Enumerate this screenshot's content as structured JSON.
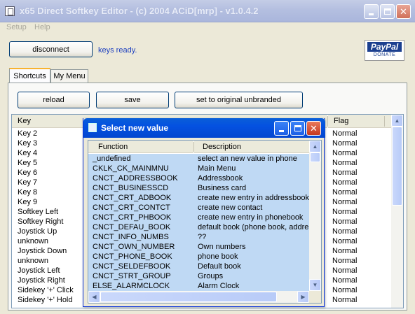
{
  "window": {
    "title": "x65 Direct Softkey Editor - (c) 2004 ACiD[mrp] - v1.0.4.2"
  },
  "menu": {
    "items": [
      "Setup",
      "Help"
    ]
  },
  "toolbar": {
    "disconnect_label": "disconnect",
    "status_text": "keys ready."
  },
  "donate": {
    "brand": "PayPal",
    "label": "DONATE"
  },
  "tabs": [
    {
      "label": "Shortcuts",
      "active": true
    },
    {
      "label": "My Menu",
      "active": false
    }
  ],
  "actions": {
    "reload_label": "reload",
    "save_label": "save",
    "reset_label": "set to original unbranded"
  },
  "key_list": {
    "columns": {
      "key": "Key",
      "flag": "Flag"
    },
    "rows": [
      {
        "key": "Key 2",
        "flag": "Normal"
      },
      {
        "key": "Key 3",
        "flag": "Normal"
      },
      {
        "key": "Key 4",
        "flag": "Normal"
      },
      {
        "key": "Key 5",
        "flag": "Normal"
      },
      {
        "key": "Key 6",
        "flag": "Normal"
      },
      {
        "key": "Key 7",
        "flag": "Normal"
      },
      {
        "key": "Key 8",
        "flag": "Normal"
      },
      {
        "key": "Key 9",
        "flag": "Normal"
      },
      {
        "key": "Softkey Left",
        "flag": "Normal"
      },
      {
        "key": "Softkey Right",
        "flag": "Normal"
      },
      {
        "key": "Joystick Up",
        "flag": "Normal"
      },
      {
        "key": "unknown",
        "flag": "Normal"
      },
      {
        "key": "Joystick Down",
        "flag": "Normal"
      },
      {
        "key": "unknown",
        "flag": "Normal"
      },
      {
        "key": "Joystick Left",
        "flag": "Normal"
      },
      {
        "key": "Joystick Right",
        "flag": "Normal"
      },
      {
        "key": "Sidekey '+' Click",
        "flag": "Normal"
      },
      {
        "key": "Sidekey '+' Hold",
        "flag": "Normal"
      }
    ]
  },
  "dialog": {
    "title": "Select new value",
    "columns": {
      "function": "Function",
      "description": "Description"
    },
    "rows": [
      {
        "function": "_undefined",
        "description": "select an new value in phone"
      },
      {
        "function": "CKLK_CK_MAINMNU",
        "description": "Main Menu"
      },
      {
        "function": "CNCT_ADDRESSBOOK",
        "description": "Addressbook"
      },
      {
        "function": "CNCT_BUSINESSCD",
        "description": "Business card"
      },
      {
        "function": "CNCT_CRT_ADBOOK",
        "description": "create new entry in addressbook"
      },
      {
        "function": "CNCT_CRT_CONTCT",
        "description": "create new contact"
      },
      {
        "function": "CNCT_CRT_PHBOOK",
        "description": "create new entry in phonebook"
      },
      {
        "function": "CNCT_DEFAU_BOOK",
        "description": "default book (phone book, address"
      },
      {
        "function": "CNCT_INFO_NUMBS",
        "description": "??"
      },
      {
        "function": "CNCT_OWN_NUMBER",
        "description": "Own numbers"
      },
      {
        "function": "CNCT_PHONE_BOOK",
        "description": "phone book"
      },
      {
        "function": "CNCT_SELDEFBOOK",
        "description": "Default book"
      },
      {
        "function": "CNCT_STRT_GROUP",
        "description": "Groups"
      },
      {
        "function": "ELSE_ALARMCLOCK",
        "description": "Alarm Clock"
      }
    ]
  }
}
